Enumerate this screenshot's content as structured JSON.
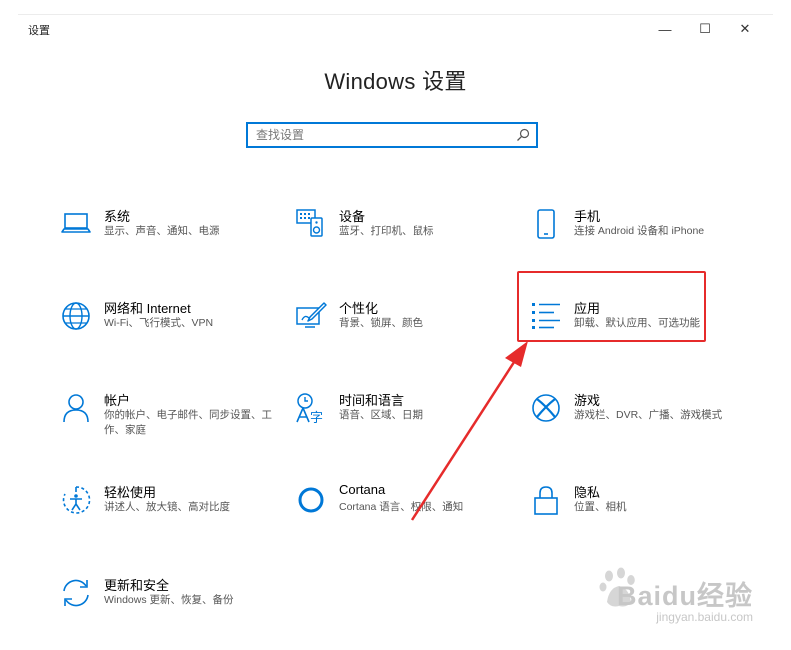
{
  "window": {
    "title": "设置",
    "minimize": "—",
    "maximize": "☐",
    "close": "✕"
  },
  "page": {
    "title": "Windows 设置"
  },
  "search": {
    "placeholder": "查找设置",
    "value": ""
  },
  "tiles": [
    {
      "id": "system",
      "icon": "laptop-icon",
      "title": "系统",
      "desc": "显示、声音、通知、电源"
    },
    {
      "id": "devices",
      "icon": "keyboard-icon",
      "title": "设备",
      "desc": "蓝牙、打印机、鼠标"
    },
    {
      "id": "phone",
      "icon": "phone-icon",
      "title": "手机",
      "desc": "连接 Android 设备和 iPhone"
    },
    {
      "id": "network",
      "icon": "globe-icon",
      "title": "网络和 Internet",
      "desc": "Wi-Fi、飞行模式、VPN"
    },
    {
      "id": "personalization",
      "icon": "paint-brush-icon",
      "title": "个性化",
      "desc": "背景、锁屏、颜色"
    },
    {
      "id": "apps",
      "icon": "apps-list-icon",
      "title": "应用",
      "desc": "卸载、默认应用、可选功能"
    },
    {
      "id": "accounts",
      "icon": "person-icon",
      "title": "帐户",
      "desc": "你的帐户、电子邮件、同步设置、工作、家庭"
    },
    {
      "id": "time-language",
      "icon": "time-language-icon",
      "title": "时间和语言",
      "desc": "语音、区域、日期"
    },
    {
      "id": "gaming",
      "icon": "xbox-icon",
      "title": "游戏",
      "desc": "游戏栏、DVR、广播、游戏模式"
    },
    {
      "id": "ease-of-access",
      "icon": "ease-of-access-icon",
      "title": "轻松使用",
      "desc": "讲述人、放大镜、高对比度"
    },
    {
      "id": "cortana",
      "icon": "cortana-circle-icon",
      "title": "Cortana",
      "desc": "Cortana 语言、权限、通知"
    },
    {
      "id": "privacy",
      "icon": "lock-icon",
      "title": "隐私",
      "desc": "位置、相机"
    },
    {
      "id": "update-security",
      "icon": "sync-arrows-icon",
      "title": "更新和安全",
      "desc": "Windows 更新、恢复、备份"
    }
  ],
  "colors": {
    "accent": "#0078d7",
    "highlight": "#e62b2b",
    "watermark": "#c7c7c7"
  },
  "watermark": {
    "brand": "Baidu经验",
    "url": "jingyan.baidu.com"
  }
}
